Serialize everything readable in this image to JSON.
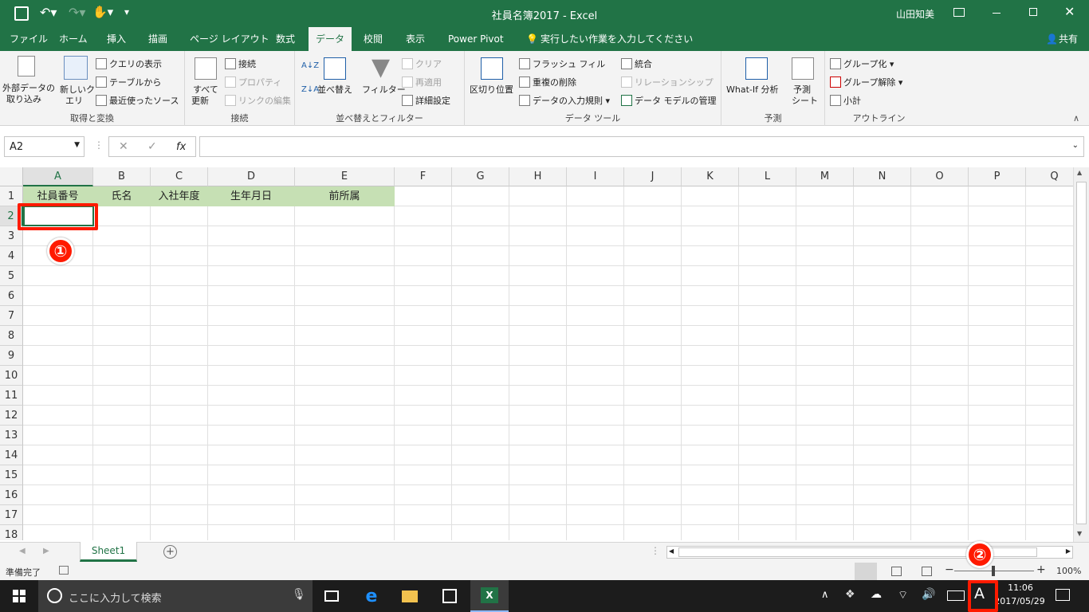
{
  "window": {
    "title": "社員名簿2017 - Excel",
    "user": "山田知美"
  },
  "tabs": [
    "ファイル",
    "ホーム",
    "挿入",
    "描画",
    "ページ レイアウト",
    "数式",
    "データ",
    "校閲",
    "表示",
    "Power Pivot"
  ],
  "active_tab": "データ",
  "tell_me": "実行したい作業を入力してください",
  "share": "共有",
  "ribbon": {
    "get_external": "外部データの",
    "get_external2": "取り込み",
    "new_query": "新しいク",
    "new_query2": "エリ",
    "show_queries": "クエリの表示",
    "from_table": "テーブルから",
    "recent_sources": "最近使ったソース",
    "group1": "取得と変換",
    "refresh_all": "すべて",
    "refresh_all2": "更新",
    "connections": "接続",
    "properties": "プロパティ",
    "edit_links": "リンクの編集",
    "group2": "接続",
    "sort": "並べ替え",
    "filter": "フィルター",
    "clear": "クリア",
    "reapply": "再適用",
    "advanced": "詳細設定",
    "group3": "並べ替えとフィルター",
    "text_to_columns": "区切り位置",
    "flash_fill": "フラッシュ フィル",
    "remove_dup": "重複の削除",
    "validation": "データの入力規則",
    "consolidate": "統合",
    "relationships": "リレーションシップ",
    "data_model": "データ モデルの管理",
    "group4": "データ ツール",
    "what_if": "What-If 分析",
    "forecast": "予測",
    "forecast2": "シート",
    "group5": "予測",
    "group_btn": "グループ化",
    "ungroup": "グループ解除",
    "subtotal": "小計",
    "group6": "アウトライン"
  },
  "formula_bar": {
    "name_box": "A2",
    "fx": "fx",
    "value": ""
  },
  "columns": [
    "A",
    "B",
    "C",
    "D",
    "E",
    "F",
    "G",
    "H",
    "I",
    "J",
    "K",
    "L",
    "M",
    "N",
    "O",
    "P",
    "Q"
  ],
  "rows": [
    "1",
    "2",
    "3",
    "4",
    "5",
    "6",
    "7",
    "8",
    "9",
    "10",
    "11",
    "12",
    "13",
    "14",
    "15",
    "16",
    "17",
    "18"
  ],
  "header_cells": [
    "社員番号",
    "氏名",
    "入社年度",
    "生年月日",
    "前所属"
  ],
  "sheet_tab": "Sheet1",
  "status": {
    "ready": "準備完了",
    "zoom": "100%"
  },
  "taskbar": {
    "search_placeholder": "ここに入力して検索",
    "time": "11:06",
    "date": "2017/05/29",
    "ime": "A"
  },
  "annotations": {
    "mark1": "①",
    "mark2": "②"
  },
  "colors": {
    "excel_green": "#217346",
    "header_fill": "#c6e0b4",
    "annotation_red": "#ff1a00"
  }
}
